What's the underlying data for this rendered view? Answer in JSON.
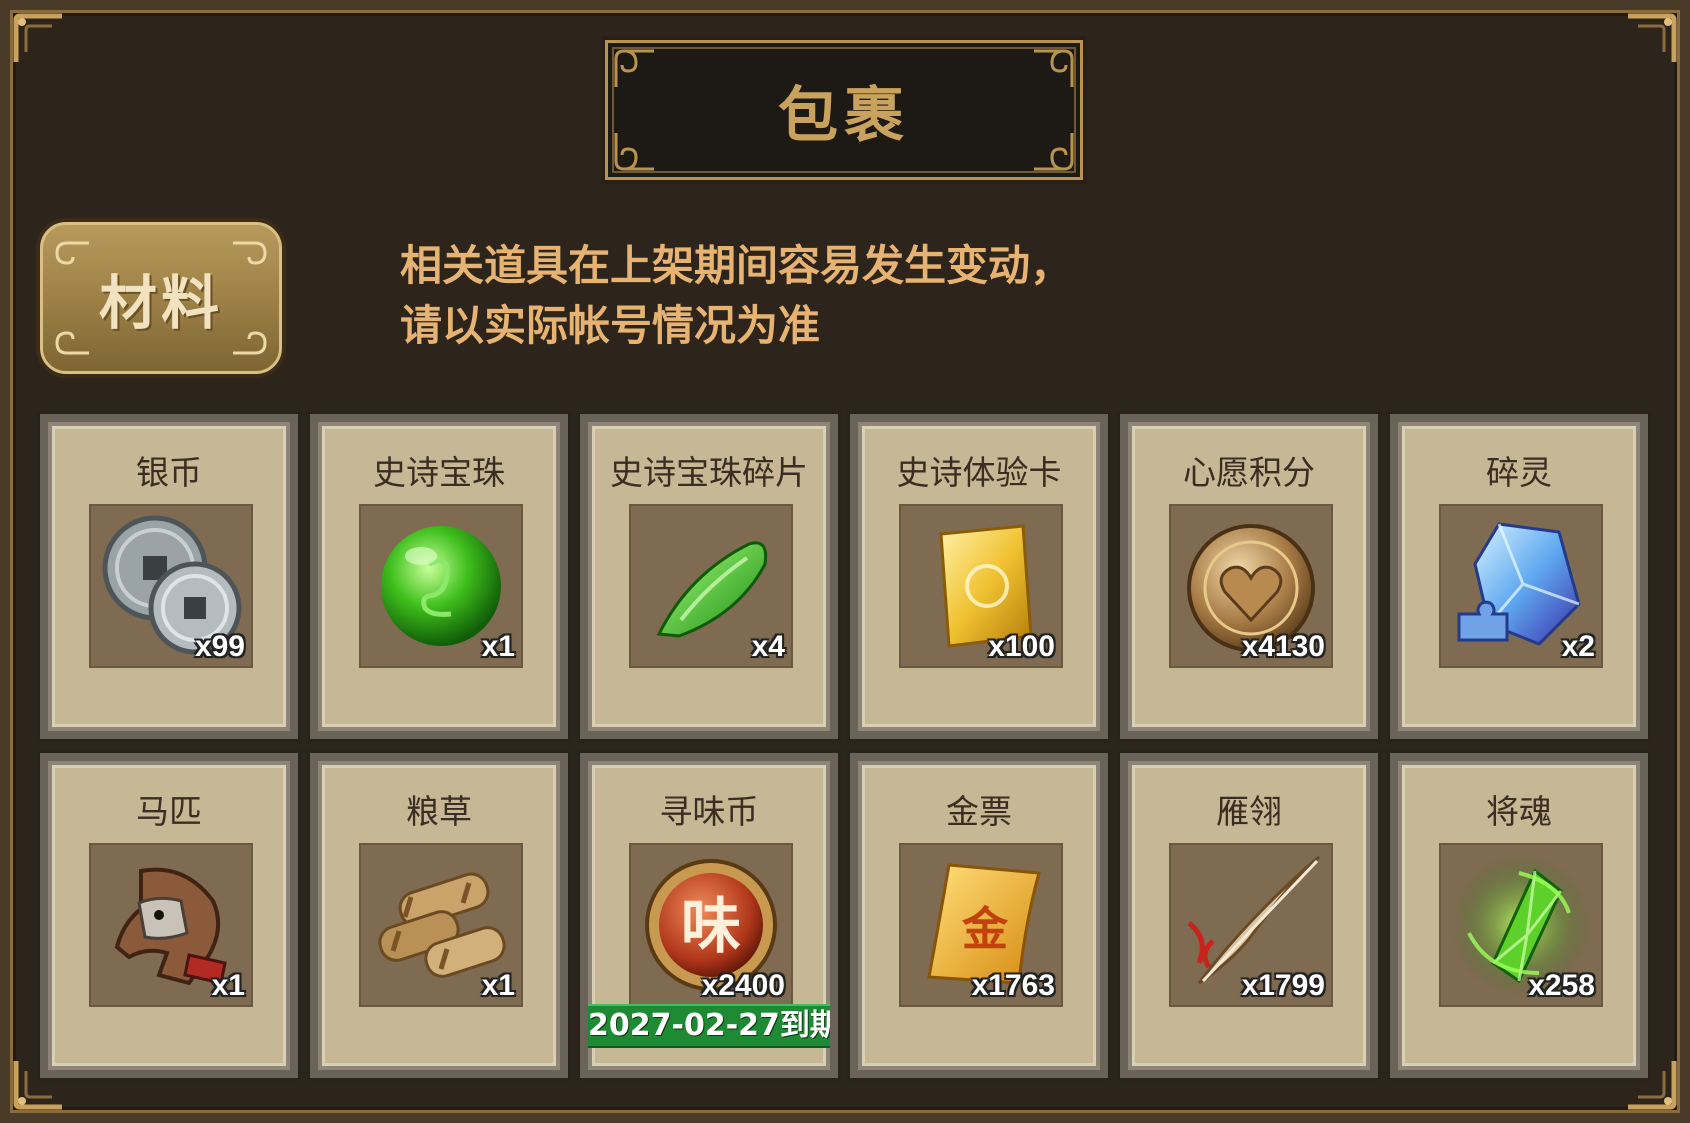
{
  "window": {
    "title": "包裹"
  },
  "tab": {
    "label": "材料"
  },
  "notice": {
    "line1": "相关道具在上架期间容易发生变动，",
    "line2": "请以实际帐号情况为准"
  },
  "items": [
    {
      "name": "银币",
      "qty": "x99",
      "icon": "silver-coin-icon"
    },
    {
      "name": "史诗宝珠",
      "qty": "x1",
      "icon": "green-orb-icon"
    },
    {
      "name": "史诗宝珠碎片",
      "qty": "x4",
      "icon": "green-shard-icon"
    },
    {
      "name": "史诗体验卡",
      "qty": "x100",
      "icon": "gold-card-icon"
    },
    {
      "name": "心愿积分",
      "qty": "x4130",
      "icon": "heart-coin-icon"
    },
    {
      "name": "碎灵",
      "qty": "x2",
      "icon": "blue-crystal-icon"
    },
    {
      "name": "马匹",
      "qty": "x1",
      "icon": "horse-icon"
    },
    {
      "name": "粮草",
      "qty": "x1",
      "icon": "hay-bundle-icon"
    },
    {
      "name": "寻味币",
      "qty": "x2400",
      "icon": "flavor-coin-icon",
      "expire": "2027-02-27到期"
    },
    {
      "name": "金票",
      "qty": "x1763",
      "icon": "gold-ticket-icon"
    },
    {
      "name": "雁翎",
      "qty": "x1799",
      "icon": "feather-icon"
    },
    {
      "name": "将魂",
      "qty": "x258",
      "icon": "green-soul-crystal-icon"
    }
  ],
  "colors": {
    "accent_gold": "#c9a25e",
    "notice_text": "#e6b373",
    "expire_badge": "#1f8a34"
  }
}
